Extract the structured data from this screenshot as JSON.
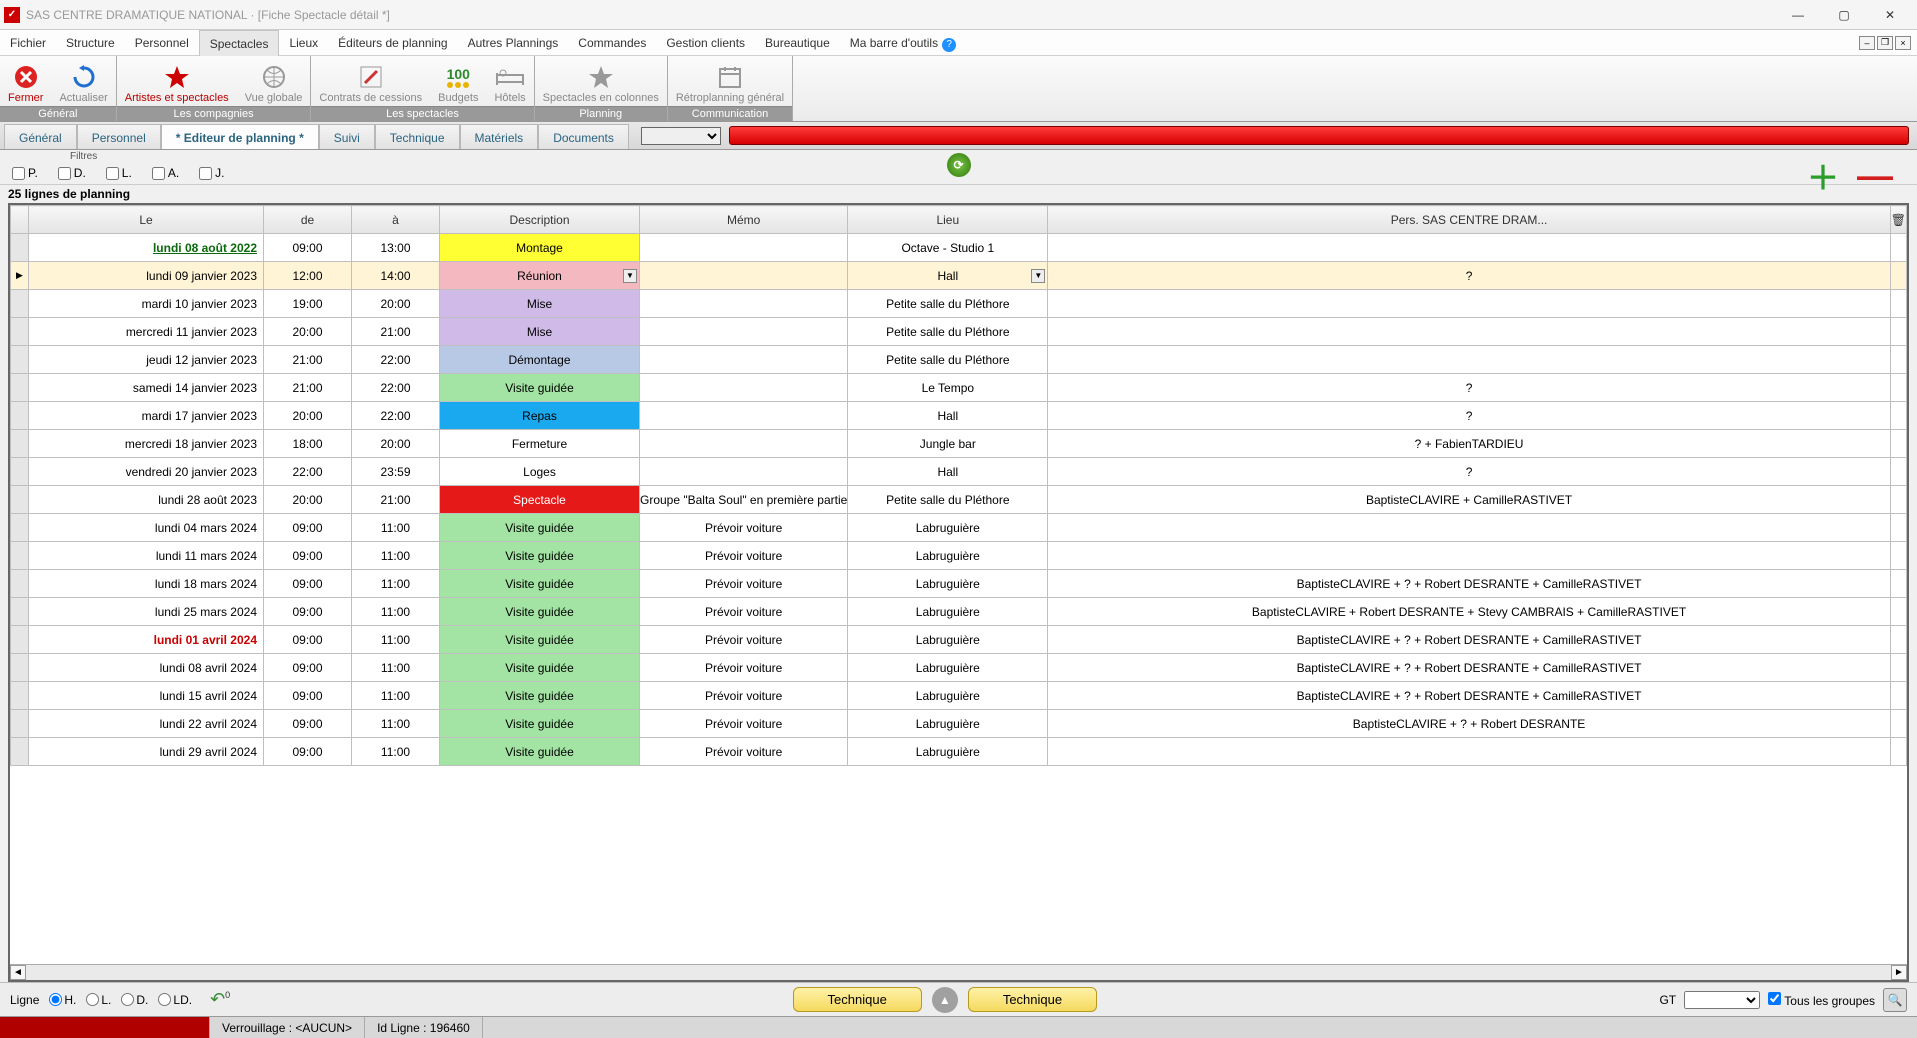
{
  "window": {
    "title": "SAS CENTRE DRAMATIQUE NATIONAL · [Fiche Spectacle détail *]"
  },
  "menu": {
    "items": [
      "Fichier",
      "Structure",
      "Personnel",
      "Spectacles",
      "Lieux",
      "Éditeurs de planning",
      "Autres Plannings",
      "Commandes",
      "Gestion clients",
      "Bureautique",
      "Ma barre d'outils"
    ],
    "active_index": 3
  },
  "ribbon": {
    "groups": [
      {
        "label": "Général",
        "buttons": [
          {
            "icon": "close",
            "label": "Fermer",
            "color": "red"
          },
          {
            "icon": "refresh",
            "label": "Actualiser",
            "color": "blue"
          }
        ]
      },
      {
        "label": "Les compagnies",
        "buttons": [
          {
            "icon": "star",
            "label": "Artistes et spectacles",
            "color": "red"
          },
          {
            "icon": "globe",
            "label": "Vue globale",
            "color": "grey"
          }
        ]
      },
      {
        "label": "Les spectacles",
        "buttons": [
          {
            "icon": "pen",
            "label": "Contrats de cessions",
            "color": "grey"
          },
          {
            "icon": "100",
            "label": "Budgets",
            "color": "grey"
          },
          {
            "icon": "bed",
            "label": "Hôtels",
            "color": "grey"
          }
        ]
      },
      {
        "label": "Planning",
        "buttons": [
          {
            "icon": "star",
            "label": "Spectacles en colonnes",
            "color": "grey"
          }
        ]
      },
      {
        "label": "Communication",
        "buttons": [
          {
            "icon": "calendar",
            "label": "Rétroplanning général",
            "color": "grey"
          }
        ]
      }
    ]
  },
  "subtabs": {
    "items": [
      "Général",
      "Personnel",
      "* Editeur de planning *",
      "Suivi",
      "Technique",
      "Matériels",
      "Documents"
    ],
    "active_index": 2
  },
  "filters": {
    "label": "Filtres",
    "checks": [
      "P.",
      "D.",
      "L.",
      "A.",
      "J."
    ]
  },
  "count_line": "25 lignes de planning",
  "columns": [
    "Le",
    "de",
    "à",
    "Description",
    "Mémo",
    "Lieu",
    "Pers. SAS CENTRE DRAM..."
  ],
  "rows": [
    {
      "date": "lundi 08 août 2022",
      "de": "09:00",
      "a": "13:00",
      "desc": "Montage",
      "memo": "",
      "lieu": "Octave - Studio 1",
      "ext": "",
      "desc_bg": "#ffff33",
      "date_style": "link"
    },
    {
      "date": "lundi 09 janvier 2023",
      "de": "12:00",
      "a": "14:00",
      "desc": "Réunion",
      "memo": "",
      "lieu": "Hall",
      "ext": "?",
      "desc_bg": "#f4b9c0",
      "selected": true,
      "desc_dd": true,
      "lieu_dd": true
    },
    {
      "date": "mardi 10 janvier 2023",
      "de": "19:00",
      "a": "20:00",
      "desc": "Mise",
      "memo": "",
      "lieu": "Petite salle du Pléthore",
      "ext": "",
      "desc_bg": "#d0bbe8"
    },
    {
      "date": "mercredi 11 janvier 2023",
      "de": "20:00",
      "a": "21:00",
      "desc": "Mise",
      "memo": "",
      "lieu": "Petite salle du Pléthore",
      "ext": "",
      "desc_bg": "#d0bbe8"
    },
    {
      "date": "jeudi 12 janvier 2023",
      "de": "21:00",
      "a": "22:00",
      "desc": "Démontage",
      "memo": "",
      "lieu": "Petite salle du Pléthore",
      "ext": "",
      "desc_bg": "#b8c9e6"
    },
    {
      "date": "samedi 14 janvier 2023",
      "de": "21:00",
      "a": "22:00",
      "desc": "Visite guidée",
      "memo": "",
      "lieu": "Le Tempo",
      "ext": "?",
      "desc_bg": "#a3e3a3"
    },
    {
      "date": "mardi 17 janvier 2023",
      "de": "20:00",
      "a": "22:00",
      "desc": "Repas",
      "memo": "",
      "lieu": "Hall",
      "ext": "?",
      "desc_bg": "#1aa9ef"
    },
    {
      "date": "mercredi 18 janvier 2023",
      "de": "18:00",
      "a": "20:00",
      "desc": "Fermeture",
      "memo": "",
      "lieu": "Jungle bar",
      "ext": "? + FabienTARDIEU",
      "desc_bg": "#ffffff"
    },
    {
      "date": "vendredi 20 janvier 2023",
      "de": "22:00",
      "a": "23:59",
      "desc": "Loges",
      "memo": "",
      "lieu": "Hall",
      "ext": "?",
      "desc_bg": "#ffffff"
    },
    {
      "date": "lundi 28 août 2023",
      "de": "20:00",
      "a": "21:00",
      "desc": "Spectacle",
      "memo": "Groupe \"Balta Soul\" en première partie",
      "lieu": "Petite salle du Pléthore",
      "ext": "BaptisteCLAVIRE + CamilleRASTIVET",
      "desc_bg": "#e61919",
      "desc_fg": "#ffffff"
    },
    {
      "date": "lundi 04 mars 2024",
      "de": "09:00",
      "a": "11:00",
      "desc": "Visite guidée",
      "memo": "Prévoir voiture",
      "lieu": "Labruguière",
      "ext": "",
      "desc_bg": "#a3e3a3"
    },
    {
      "date": "lundi 11 mars 2024",
      "de": "09:00",
      "a": "11:00",
      "desc": "Visite guidée",
      "memo": "Prévoir voiture",
      "lieu": "Labruguière",
      "ext": "",
      "desc_bg": "#a3e3a3"
    },
    {
      "date": "lundi 18 mars 2024",
      "de": "09:00",
      "a": "11:00",
      "desc": "Visite guidée",
      "memo": "Prévoir voiture",
      "lieu": "Labruguière",
      "ext": "BaptisteCLAVIRE + ? + Robert DESRANTE + CamilleRASTIVET",
      "desc_bg": "#a3e3a3"
    },
    {
      "date": "lundi 25 mars 2024",
      "de": "09:00",
      "a": "11:00",
      "desc": "Visite guidée",
      "memo": "Prévoir voiture",
      "lieu": "Labruguière",
      "ext": "BaptisteCLAVIRE + Robert DESRANTE + Stevy CAMBRAIS + CamilleRASTIVET",
      "desc_bg": "#a3e3a3"
    },
    {
      "date": "lundi 01 avril 2024",
      "de": "09:00",
      "a": "11:00",
      "desc": "Visite guidée",
      "memo": "Prévoir voiture",
      "lieu": "Labruguière",
      "ext": "BaptisteCLAVIRE + ? + Robert DESRANTE + CamilleRASTIVET",
      "desc_bg": "#a3e3a3",
      "date_style": "red"
    },
    {
      "date": "lundi 08 avril 2024",
      "de": "09:00",
      "a": "11:00",
      "desc": "Visite guidée",
      "memo": "Prévoir voiture",
      "lieu": "Labruguière",
      "ext": "BaptisteCLAVIRE + ? + Robert DESRANTE + CamilleRASTIVET",
      "desc_bg": "#a3e3a3"
    },
    {
      "date": "lundi 15 avril 2024",
      "de": "09:00",
      "a": "11:00",
      "desc": "Visite guidée",
      "memo": "Prévoir voiture",
      "lieu": "Labruguière",
      "ext": "BaptisteCLAVIRE + ? + Robert DESRANTE + CamilleRASTIVET",
      "desc_bg": "#a3e3a3"
    },
    {
      "date": "lundi 22 avril 2024",
      "de": "09:00",
      "a": "11:00",
      "desc": "Visite guidée",
      "memo": "Prévoir voiture",
      "lieu": "Labruguière",
      "ext": "BaptisteCLAVIRE + ? + Robert DESRANTE",
      "desc_bg": "#a3e3a3"
    },
    {
      "date": "lundi 29 avril 2024",
      "de": "09:00",
      "a": "11:00",
      "desc": "Visite guidée",
      "memo": "Prévoir voiture",
      "lieu": "Labruguière",
      "ext": "",
      "desc_bg": "#a3e3a3"
    }
  ],
  "bottom": {
    "ligne_label": "Ligne",
    "radios": [
      "H.",
      "L.",
      "D.",
      "LD."
    ],
    "radio_checked": 0,
    "undo_badge": "0",
    "btn1": "Technique",
    "btn2": "Technique",
    "gt_label": "GT",
    "tous_groupes": "Tous les groupes"
  },
  "status": {
    "verrouillage": "Verrouillage : <AUCUN>",
    "idligne": "Id Ligne : 196460"
  }
}
